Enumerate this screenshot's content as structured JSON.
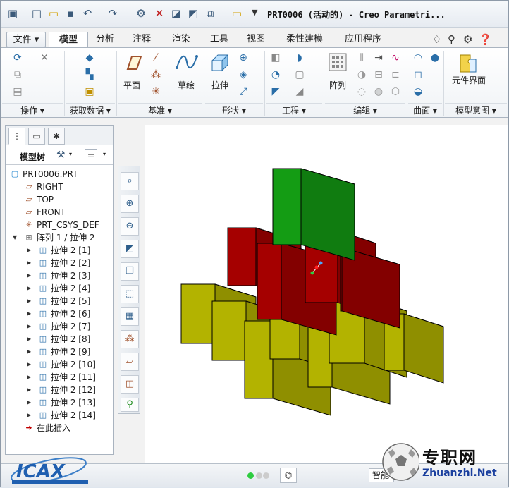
{
  "titlebar": {
    "title": "PRT0006 (活动的) - Creo Parametri...",
    "quick_access": [
      "new-icon",
      "open-icon",
      "save-icon",
      "undo-icon",
      "redo-icon",
      "regenerate-icon",
      "windows-icon",
      "close-window-icon",
      "folder-icon"
    ]
  },
  "tabs": {
    "file": "文件",
    "items": [
      "模型",
      "分析",
      "注释",
      "渲染",
      "工具",
      "视图",
      "柔性建模",
      "应用程序"
    ],
    "active": "模型"
  },
  "ribbon": {
    "groups": [
      {
        "label": "操作"
      },
      {
        "label": "获取数据"
      },
      {
        "label": "基准"
      },
      {
        "label": "形状"
      },
      {
        "label": "工程"
      },
      {
        "label": "编辑"
      },
      {
        "label": "曲面"
      },
      {
        "label": "模型意图"
      }
    ],
    "big_buttons": {
      "plane": "平面",
      "sketch": "草绘",
      "extrude": "拉伸",
      "pattern": "阵列",
      "component_interface": "元件界面"
    }
  },
  "model_tree": {
    "title": "模型树",
    "root": "PRT0006.PRT",
    "datums": [
      "RIGHT",
      "TOP",
      "FRONT",
      "PRT_CSYS_DEF"
    ],
    "pattern": "阵列 1 / 拉伸 2",
    "items": [
      "拉伸 2 [1]",
      "拉伸 2 [2]",
      "拉伸 2 [3]",
      "拉伸 2 [4]",
      "拉伸 2 [5]",
      "拉伸 2 [6]",
      "拉伸 2 [7]",
      "拉伸 2 [8]",
      "拉伸 2 [9]",
      "拉伸 2 [10]",
      "拉伸 2 [11]",
      "拉伸 2 [12]",
      "拉伸 2 [13]",
      "拉伸 2 [14]"
    ],
    "insert_here": "在此插入"
  },
  "statusbar": {
    "smart": "智能"
  },
  "watermark": {
    "right_title": "专职网",
    "right_url": "Zhuanzhi.Net",
    "left_logo": "ICAX"
  },
  "colors": {
    "green_cube": "#19c819",
    "red_cube": "#d40000",
    "yellow_cube": "#e6e600"
  }
}
